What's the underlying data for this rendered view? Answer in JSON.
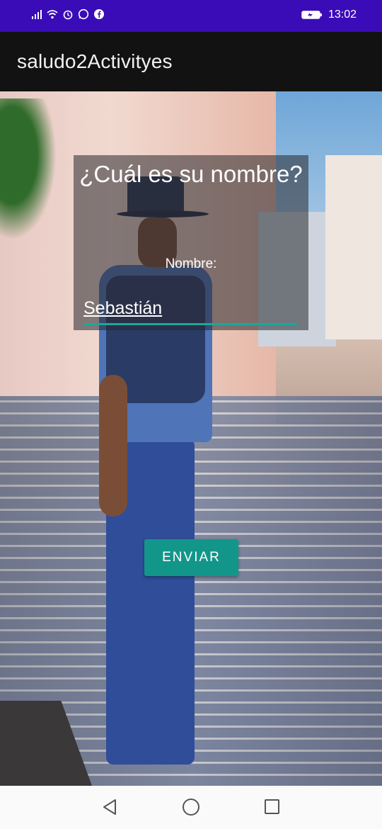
{
  "status_bar": {
    "time": "13:02",
    "icons": [
      "signal-icon",
      "wifi-icon",
      "alarm-icon",
      "whatsapp-icon",
      "facebook-icon",
      "battery-charging-icon"
    ]
  },
  "app_bar": {
    "title": "saludo2Activityes"
  },
  "dialog": {
    "title": "¿Cuál es su nombre?",
    "name_label": "Nombre:",
    "name_value": "Sebastián"
  },
  "actions": {
    "send_label": "ENVIAR"
  },
  "nav_bar": {
    "icons": [
      "back-icon",
      "home-icon",
      "recents-icon"
    ]
  },
  "colors": {
    "status_bar": "#3a0cb8",
    "app_bar": "#121212",
    "accent": "#13968a"
  }
}
